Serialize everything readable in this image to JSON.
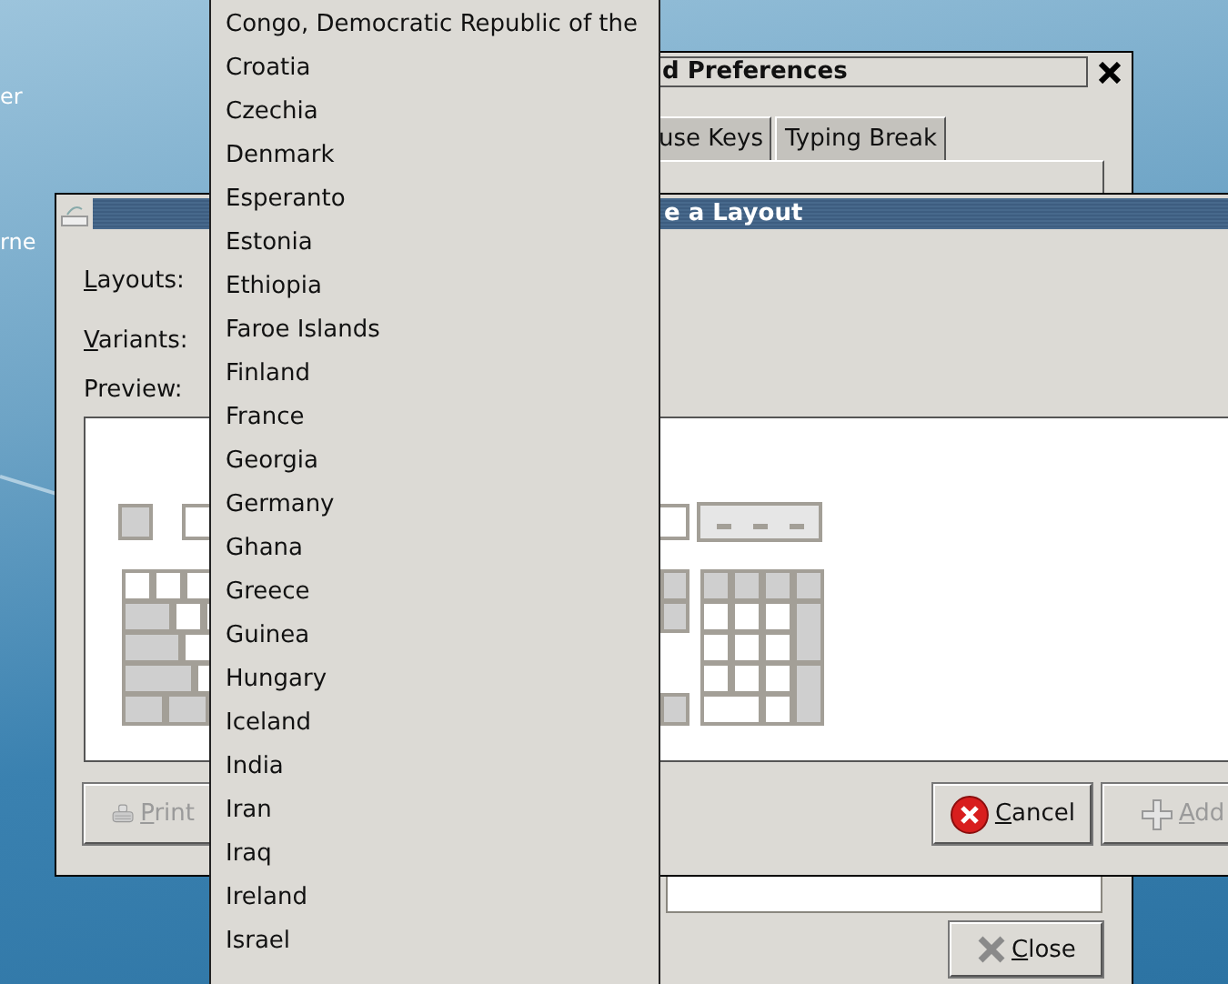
{
  "desktop": {
    "icon_labels": [
      "er",
      "rne"
    ]
  },
  "preferences_window": {
    "title": "d Preferences",
    "tabs": [
      {
        "label": "use Keys",
        "selected": false
      },
      {
        "label": "Typing Break",
        "selected": false
      }
    ],
    "buttons": [
      {
        "label": "Close",
        "kind": "close",
        "disabled": false
      }
    ]
  },
  "layout_dialog": {
    "title": "e a Layout",
    "fields": [
      {
        "label": "Layouts:"
      },
      {
        "label": "Variants:"
      }
    ],
    "preview_label": "Preview:",
    "buttons": [
      {
        "label": "Print",
        "kind": "print",
        "disabled": true
      },
      {
        "label": "Cancel",
        "kind": "cancel",
        "disabled": false
      },
      {
        "label": "Add",
        "kind": "add",
        "disabled": true
      }
    ]
  },
  "dropdown": {
    "items": [
      "Congo, Democratic Republic of the",
      "Croatia",
      "Czechia",
      "Denmark",
      "Esperanto",
      "Estonia",
      "Ethiopia",
      "Faroe Islands",
      "Finland",
      "France",
      "Georgia",
      "Germany",
      "Ghana",
      "Greece",
      "Guinea",
      "Hungary",
      "Iceland",
      "India",
      "Iran",
      "Iraq",
      "Ireland",
      "Israel"
    ]
  }
}
